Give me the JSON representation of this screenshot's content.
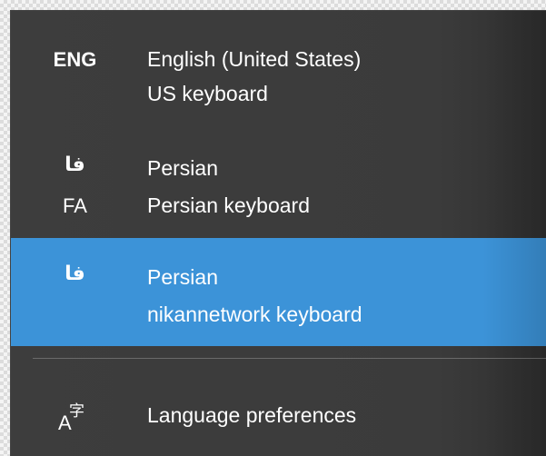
{
  "languages": [
    {
      "code_line1": "ENG",
      "code_line2": "",
      "name": "English (United States)",
      "keyboard": "US keyboard",
      "selected": false
    },
    {
      "code_line1": "فا",
      "code_line2": "FA",
      "name": "Persian",
      "keyboard": "Persian keyboard",
      "selected": false
    },
    {
      "code_line1": "فا",
      "code_line2": "",
      "name": "Persian",
      "keyboard": "nikannetwork keyboard",
      "selected": true
    }
  ],
  "preferences": {
    "label": "Language preferences",
    "icon": "language-preferences-icon"
  },
  "colors": {
    "flyout_bg": "#3b3b3b",
    "selected_bg": "#3c93d8",
    "text": "#ffffff",
    "divider": "#6a6a6a"
  }
}
